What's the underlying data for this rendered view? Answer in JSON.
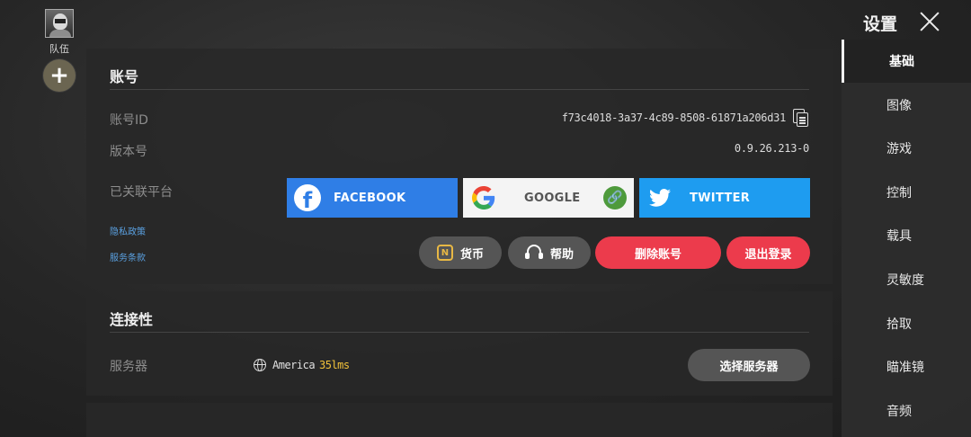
{
  "team": {
    "label": "队伍",
    "add_symbol": "+"
  },
  "header": {
    "title": "设置"
  },
  "account": {
    "title": "账号",
    "id_label": "账号ID",
    "id_value": "f73c4018-3a37-4c89-8508-61871a206d31",
    "version_label": "版本号",
    "version_value": "0.9.26.213-0",
    "linked_label": "已关联平台",
    "platforms": {
      "facebook": "FACEBOOK",
      "google": "GOOGLE",
      "twitter": "TWITTER"
    },
    "privacy_link": "隐私政策",
    "terms_link": "服务条款",
    "currency_button": "货币",
    "help_button": "帮助",
    "delete_button": "删除账号",
    "logout_button": "退出登录"
  },
  "connectivity": {
    "title": "连接性",
    "server_label": "服务器",
    "server_name": "America",
    "ping": "35lms",
    "select_button": "选择服务器"
  },
  "nav": {
    "items": [
      "基础",
      "图像",
      "游戏",
      "控制",
      "载具",
      "灵敏度",
      "拾取",
      "瞄准镜",
      "音频"
    ],
    "active_index": 0
  },
  "colors": {
    "facebook": "#2f7ee6",
    "twitter": "#1e9cf0",
    "danger": "#ec3b4c",
    "ping": "#f2c23a",
    "link": "#5aa0e0"
  }
}
